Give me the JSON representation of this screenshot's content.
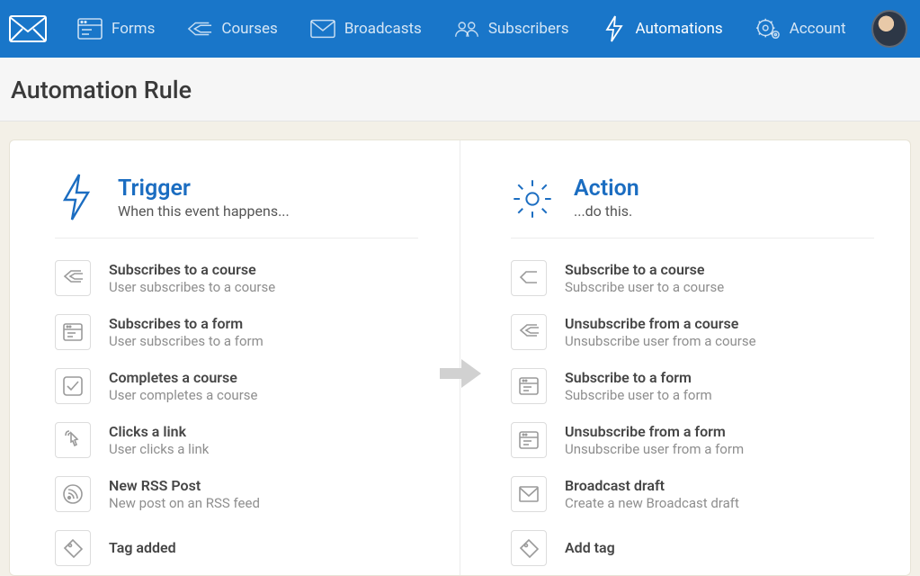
{
  "nav": {
    "active": "automations",
    "items": [
      {
        "id": "forms",
        "label": "Forms"
      },
      {
        "id": "courses",
        "label": "Courses"
      },
      {
        "id": "broadcasts",
        "label": "Broadcasts"
      },
      {
        "id": "subscribers",
        "label": "Subscribers"
      },
      {
        "id": "automations",
        "label": "Automations"
      },
      {
        "id": "account",
        "label": "Account"
      }
    ]
  },
  "page": {
    "title": "Automation Rule"
  },
  "trigger": {
    "title": "Trigger",
    "subtitle": "When this event happens...",
    "options": [
      {
        "icon": "reply-all",
        "title": "Subscribes to a course",
        "sub": "User subscribes to a course"
      },
      {
        "icon": "form",
        "title": "Subscribes to a form",
        "sub": "User subscribes to a form"
      },
      {
        "icon": "check",
        "title": "Completes a course",
        "sub": "User completes a course"
      },
      {
        "icon": "pointer",
        "title": "Clicks a link",
        "sub": "User clicks a link"
      },
      {
        "icon": "rss",
        "title": "New RSS Post",
        "sub": "New post on an RSS feed"
      },
      {
        "icon": "tag",
        "title": "Tag added",
        "sub": ""
      }
    ]
  },
  "action": {
    "title": "Action",
    "subtitle": "...do this.",
    "options": [
      {
        "icon": "reply",
        "title": "Subscribe to a course",
        "sub": "Subscribe user to a course"
      },
      {
        "icon": "reply-all",
        "title": "Unsubscribe from a course",
        "sub": "Unsubscribe user from a course"
      },
      {
        "icon": "form",
        "title": "Subscribe to a form",
        "sub": "Subscribe user to a form"
      },
      {
        "icon": "form",
        "title": "Unsubscribe from a form",
        "sub": "Unsubscribe user from a form"
      },
      {
        "icon": "mail",
        "title": "Broadcast draft",
        "sub": "Create a new Broadcast draft"
      },
      {
        "icon": "tag",
        "title": "Add tag",
        "sub": ""
      }
    ]
  }
}
